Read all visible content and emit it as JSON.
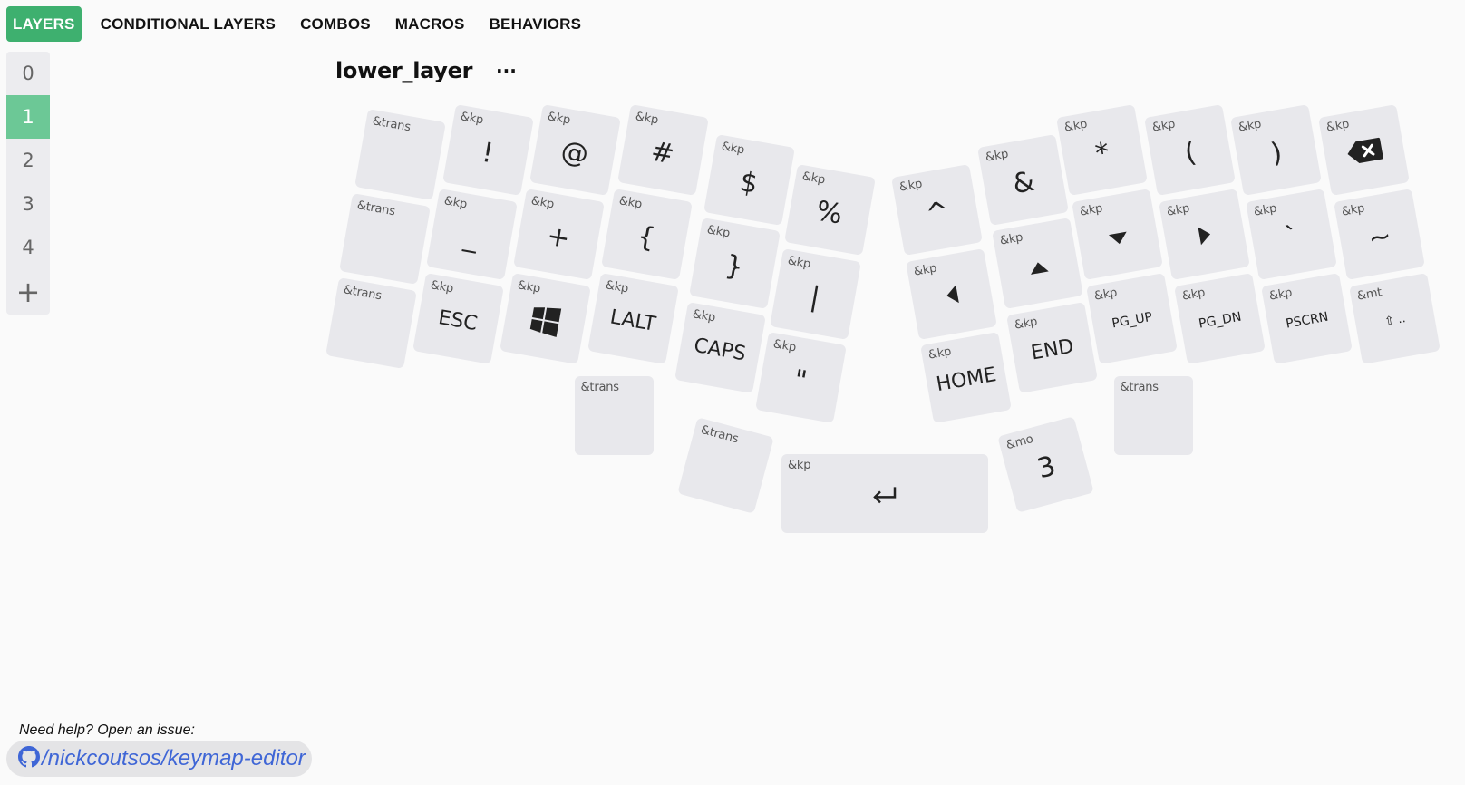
{
  "nav": {
    "tabs": [
      {
        "label": "LAYERS",
        "active": true
      },
      {
        "label": "CONDITIONAL LAYERS",
        "active": false
      },
      {
        "label": "COMBOS",
        "active": false
      },
      {
        "label": "MACROS",
        "active": false
      },
      {
        "label": "BEHAVIORS",
        "active": false
      }
    ]
  },
  "layers": {
    "items": [
      "0",
      "1",
      "2",
      "3",
      "4"
    ],
    "active_index": 1,
    "add_label": "+"
  },
  "layer": {
    "title": "lower_layer",
    "menu_label": "···"
  },
  "keys": [
    {
      "behavior": "&trans",
      "legend": ""
    },
    {
      "behavior": "&kp",
      "legend": "!"
    },
    {
      "behavior": "&kp",
      "legend": "@"
    },
    {
      "behavior": "&kp",
      "legend": "#"
    },
    {
      "behavior": "&kp",
      "legend": "$"
    },
    {
      "behavior": "&kp",
      "legend": "%"
    },
    {
      "behavior": "&kp",
      "legend": "^"
    },
    {
      "behavior": "&kp",
      "legend": "&"
    },
    {
      "behavior": "&kp",
      "legend": "*"
    },
    {
      "behavior": "&kp",
      "legend": "("
    },
    {
      "behavior": "&kp",
      "legend": ")"
    },
    {
      "behavior": "&kp",
      "legend": "",
      "icon": "backspace-icon"
    },
    {
      "behavior": "&trans",
      "legend": ""
    },
    {
      "behavior": "&kp",
      "legend": "_"
    },
    {
      "behavior": "&kp",
      "legend": "+"
    },
    {
      "behavior": "&kp",
      "legend": "{"
    },
    {
      "behavior": "&kp",
      "legend": "}"
    },
    {
      "behavior": "&kp",
      "legend": "|"
    },
    {
      "behavior": "&kp",
      "legend": "",
      "icon": "arrow-left-icon"
    },
    {
      "behavior": "&kp",
      "legend": "",
      "icon": "arrow-up-icon"
    },
    {
      "behavior": "&kp",
      "legend": "",
      "icon": "arrow-down-icon"
    },
    {
      "behavior": "&kp",
      "legend": "",
      "icon": "arrow-right-icon"
    },
    {
      "behavior": "&kp",
      "legend": "`"
    },
    {
      "behavior": "&kp",
      "legend": "~"
    },
    {
      "behavior": "&trans",
      "legend": ""
    },
    {
      "behavior": "&kp",
      "legend": "ESC"
    },
    {
      "behavior": "&kp",
      "legend": "",
      "icon": "windows-icon"
    },
    {
      "behavior": "&kp",
      "legend": "LALT"
    },
    {
      "behavior": "&kp",
      "legend": "CAPS"
    },
    {
      "behavior": "&kp",
      "legend": "\""
    },
    {
      "behavior": "&kp",
      "legend": "HOME"
    },
    {
      "behavior": "&kp",
      "legend": "END"
    },
    {
      "behavior": "&kp",
      "legend": "PG_UP"
    },
    {
      "behavior": "&kp",
      "legend": "PG_DN"
    },
    {
      "behavior": "&kp",
      "legend": "PSCRN"
    },
    {
      "behavior": "&mt",
      "legend": "⇧ .."
    },
    {
      "behavior": "&trans",
      "legend": ""
    },
    {
      "behavior": "&trans",
      "legend": ""
    },
    {
      "behavior": "&kp",
      "legend": "",
      "icon": "return-icon"
    },
    {
      "behavior": "&mo",
      "legend": "3"
    },
    {
      "behavior": "&trans",
      "legend": ""
    }
  ],
  "footer": {
    "help_text": "Need help? Open an issue:",
    "repo_label": "/nickcoutsos/keymap-editor"
  },
  "colors": {
    "accent": "#3eb06f",
    "accent_light": "#6cc896",
    "key_bg": "#e8e8ec",
    "link": "#3f66d6"
  }
}
